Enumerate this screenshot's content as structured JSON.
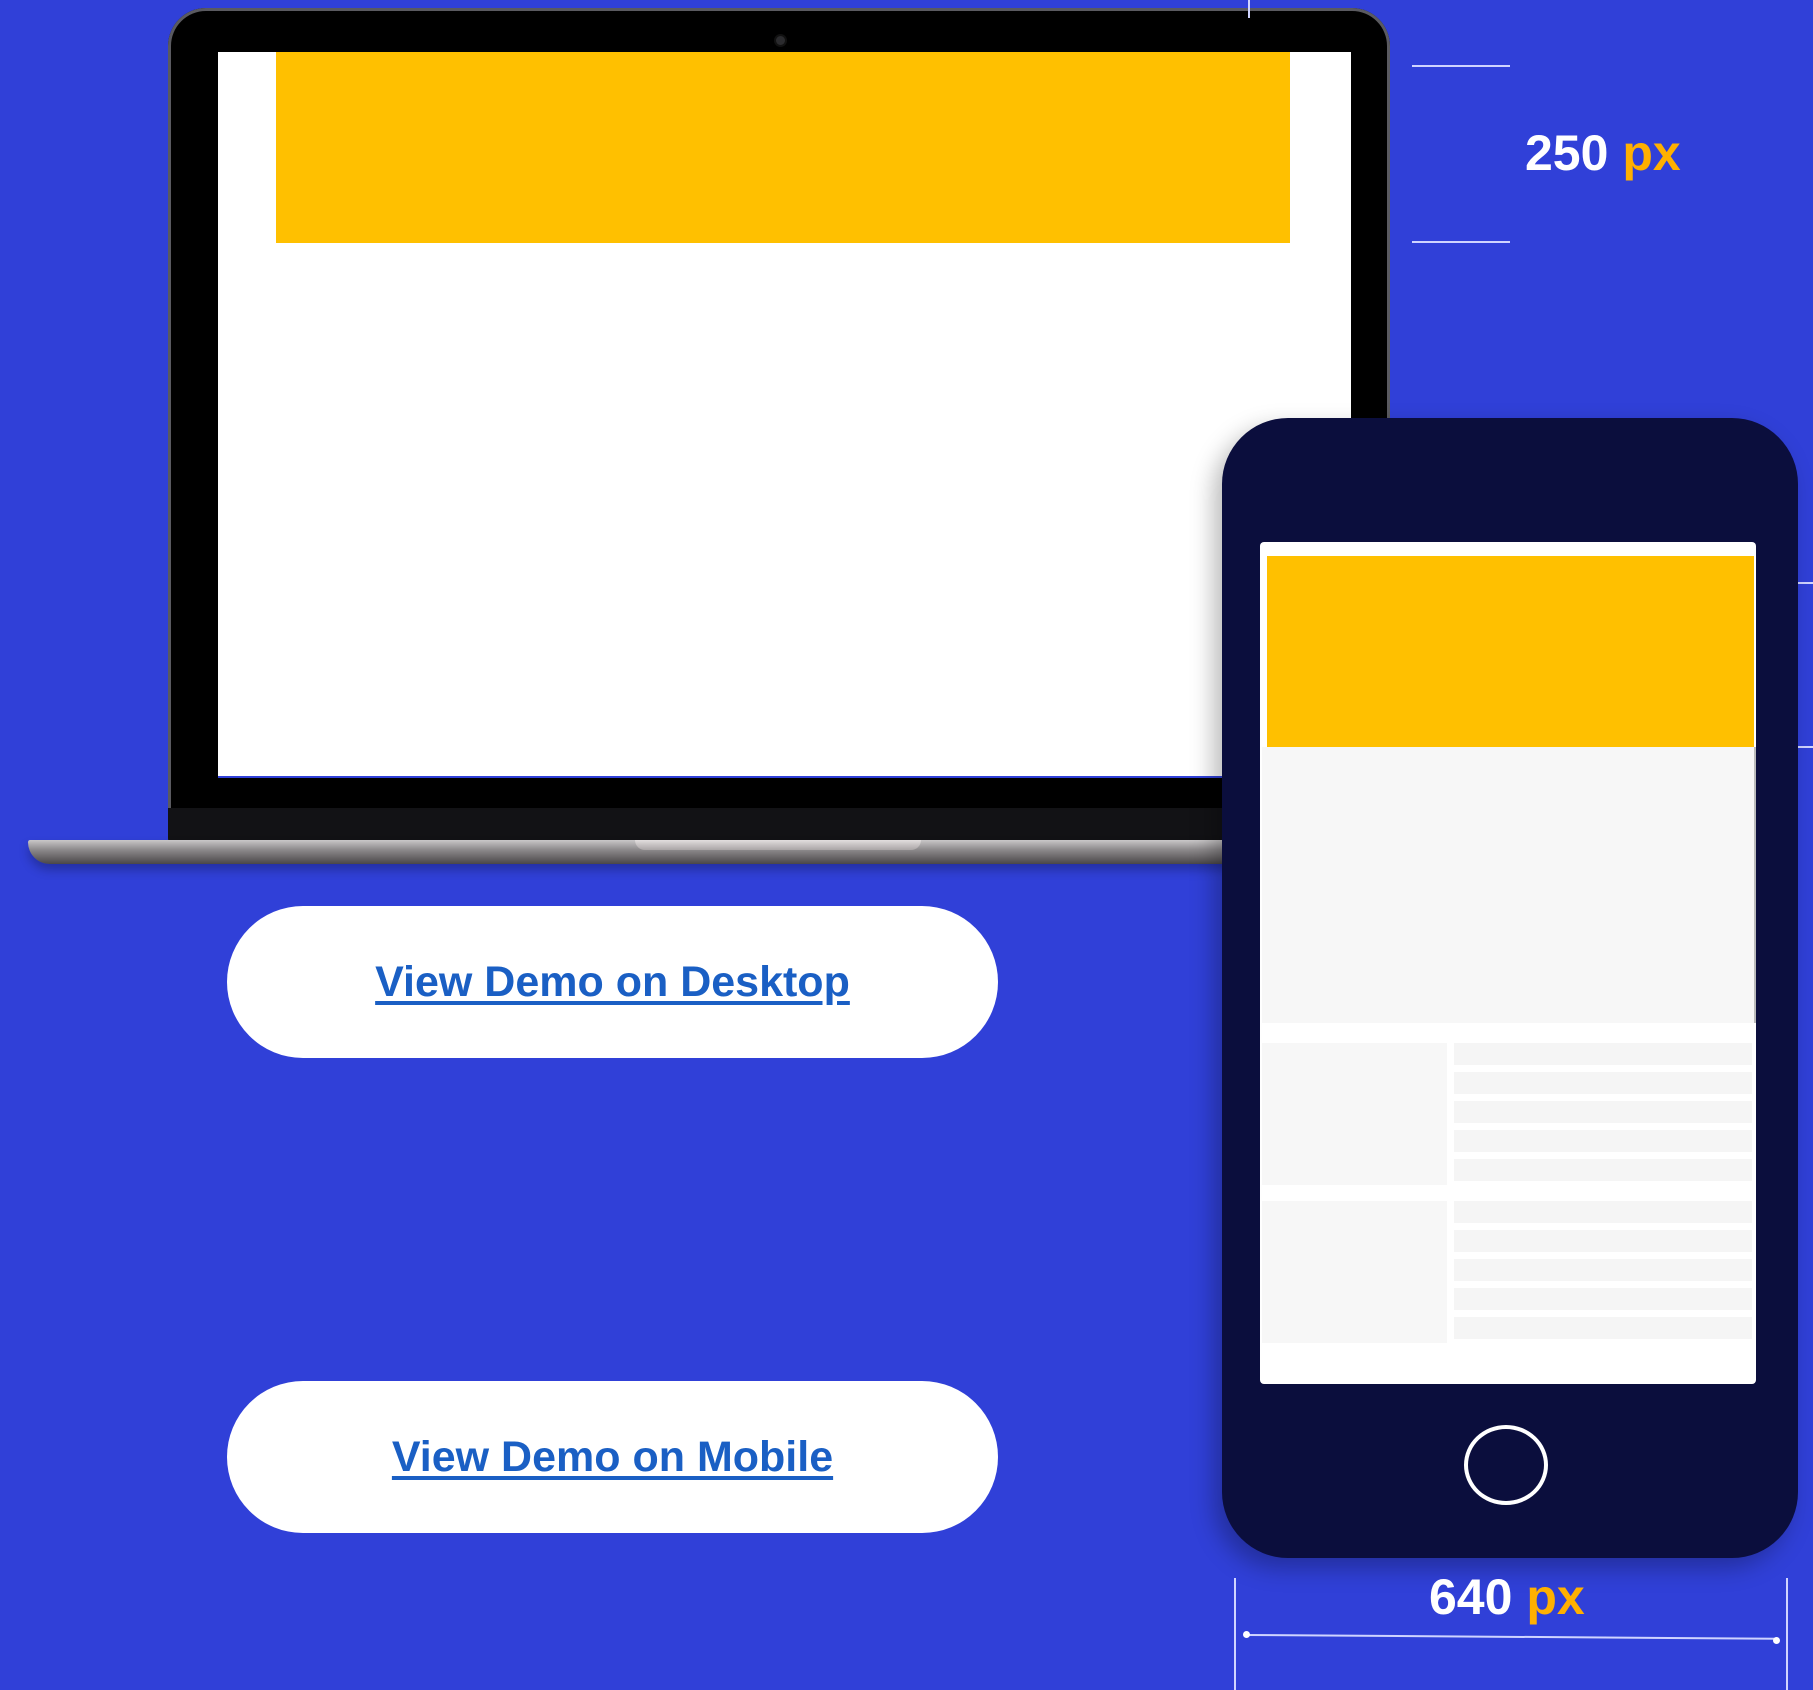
{
  "measurements": {
    "height": {
      "value": "250",
      "unit": "px"
    },
    "width": {
      "value": "640",
      "unit": "px"
    }
  },
  "buttons": {
    "desktop_label": "View Demo on Desktop",
    "mobile_label": "View Demo on Mobile"
  },
  "colors": {
    "background": "#3040d8",
    "banner": "#ffc000",
    "phone_body": "#0b0e3d",
    "link": "#1a5fc4",
    "unit_accent": "#ffb000"
  }
}
